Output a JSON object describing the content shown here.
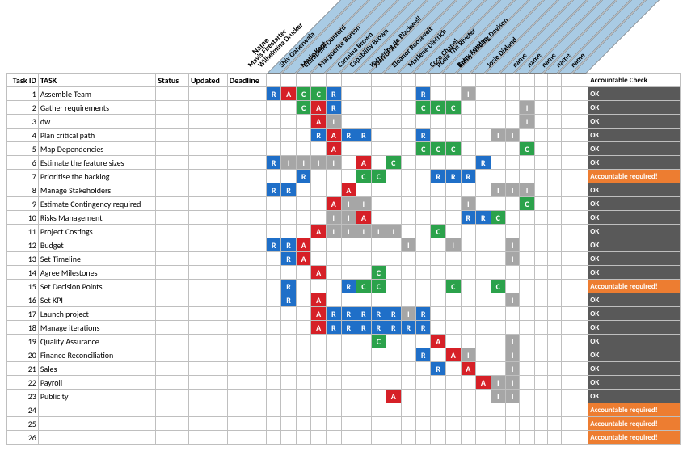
{
  "headers": {
    "id": "Task ID",
    "task": "TASK",
    "status": "Status",
    "updated": "Updated",
    "deadline": "Deadline",
    "acc": "Accountable Check",
    "nameLabel": "Name"
  },
  "people": [
    "Mavis Firestarter",
    "Wilhelmina Drucker",
    "Shiv Gaherwala",
    "Marie Kent",
    "Clarabelle Dunford",
    "Marguerite Burton",
    "Carmina Brown",
    "Capability Brown",
    "Joan of Arc",
    "Katherine de Blackwell",
    "Eleanor Roosevelt",
    "Marlene Dietrich",
    "Coco Chanel",
    "Rosie The Riveter",
    "Betty Friedan",
    "Emily Wilding Davison",
    "Josie Dixland",
    "name",
    "name",
    "name",
    "name",
    "name"
  ],
  "status": {
    "ok": "OK",
    "warn": "Accountable required!"
  },
  "rows": [
    {
      "id": 1,
      "task": "Assemble Team",
      "assign": {
        "0": "R",
        "1": "A",
        "2": "C",
        "3": "C",
        "4": "R",
        "10": "R",
        "13": "I"
      },
      "acc": "ok"
    },
    {
      "id": 2,
      "task": "Gather requirements",
      "assign": {
        "2": "C",
        "3": "A",
        "4": "R",
        "10": "C",
        "11": "C",
        "12": "C",
        "17": "I"
      },
      "acc": "ok"
    },
    {
      "id": 3,
      "task": "dw",
      "assign": {
        "3": "A",
        "4": "I",
        "17": "I"
      },
      "acc": "ok"
    },
    {
      "id": 4,
      "task": "Plan critical path",
      "assign": {
        "3": "R",
        "4": "A",
        "5": "R",
        "6": "R",
        "10": "R",
        "15": "I",
        "16": "I"
      },
      "acc": "ok"
    },
    {
      "id": 5,
      "task": "Map Dependencies",
      "assign": {
        "4": "A",
        "10": "C",
        "11": "C",
        "12": "C",
        "17": "C"
      },
      "acc": "ok"
    },
    {
      "id": 6,
      "task": "Estimate the feature sizes",
      "assign": {
        "0": "R",
        "1": "I",
        "2": "I",
        "3": "I",
        "4": "I",
        "6": "A",
        "8": "C",
        "14": "R"
      },
      "acc": "ok"
    },
    {
      "id": 7,
      "task": "Prioritise the backlog",
      "assign": {
        "2": "R",
        "6": "C",
        "7": "C",
        "11": "R",
        "12": "R",
        "13": "R"
      },
      "acc": "warn"
    },
    {
      "id": 8,
      "task": "Manage Stakeholders",
      "assign": {
        "0": "R",
        "1": "R",
        "5": "A",
        "15": "I",
        "16": "I",
        "17": "I"
      },
      "acc": "ok"
    },
    {
      "id": 9,
      "task": "Estimate Contingency required",
      "assign": {
        "4": "A",
        "5": "I",
        "6": "I",
        "13": "I",
        "17": "C"
      },
      "acc": "ok"
    },
    {
      "id": 10,
      "task": "Risks Management",
      "assign": {
        "4": "I",
        "5": "I",
        "6": "A",
        "13": "R",
        "14": "R",
        "15": "C"
      },
      "acc": "ok"
    },
    {
      "id": 11,
      "task": "Project Costings",
      "assign": {
        "3": "A",
        "4": "I",
        "5": "I",
        "6": "I",
        "7": "I",
        "8": "I",
        "11": "C"
      },
      "acc": "ok"
    },
    {
      "id": 12,
      "task": "Budget",
      "assign": {
        "0": "R",
        "1": "R",
        "2": "A",
        "9": "I",
        "12": "I",
        "16": "I"
      },
      "acc": "ok"
    },
    {
      "id": 13,
      "task": "Set Timeline",
      "assign": {
        "1": "R",
        "2": "A",
        "16": "I"
      },
      "acc": "ok"
    },
    {
      "id": 14,
      "task": "Agree Milestones",
      "assign": {
        "3": "A",
        "7": "C"
      },
      "acc": "ok"
    },
    {
      "id": 15,
      "task": "Set Decision Points",
      "assign": {
        "1": "R",
        "5": "R",
        "6": "C",
        "7": "C",
        "12": "C",
        "15": "C"
      },
      "acc": "warn"
    },
    {
      "id": 16,
      "task": "Set KPI",
      "assign": {
        "1": "R",
        "3": "A",
        "16": "I"
      },
      "acc": "ok"
    },
    {
      "id": 17,
      "task": "Launch project",
      "assign": {
        "3": "A",
        "4": "R",
        "5": "R",
        "6": "R",
        "7": "R",
        "8": "R",
        "9": "I",
        "10": "R"
      },
      "acc": "ok"
    },
    {
      "id": 18,
      "task": "Manage iterations",
      "assign": {
        "3": "A",
        "4": "R",
        "5": "R",
        "6": "R",
        "7": "R",
        "8": "R",
        "9": "R",
        "10": "R"
      },
      "acc": "ok"
    },
    {
      "id": 19,
      "task": "Quality Assurance",
      "assign": {
        "7": "C",
        "11": "A",
        "16": "I"
      },
      "acc": "ok"
    },
    {
      "id": 20,
      "task": "Finance Reconciliation",
      "assign": {
        "10": "R",
        "12": "A",
        "13": "I",
        "16": "I"
      },
      "acc": "ok"
    },
    {
      "id": 21,
      "task": "Sales",
      "assign": {
        "11": "R",
        "13": "A",
        "16": "I"
      },
      "acc": "ok"
    },
    {
      "id": 22,
      "task": "Payroll",
      "assign": {
        "14": "A",
        "15": "I",
        "16": "I"
      },
      "acc": "ok"
    },
    {
      "id": 23,
      "task": "Publicity",
      "assign": {
        "8": "A",
        "15": "I",
        "16": "I"
      },
      "acc": "ok"
    },
    {
      "id": 24,
      "task": "",
      "assign": {},
      "acc": "warn"
    },
    {
      "id": 25,
      "task": "",
      "assign": {},
      "acc": "warn"
    },
    {
      "id": 26,
      "task": "",
      "assign": {},
      "acc": "warn"
    }
  ]
}
